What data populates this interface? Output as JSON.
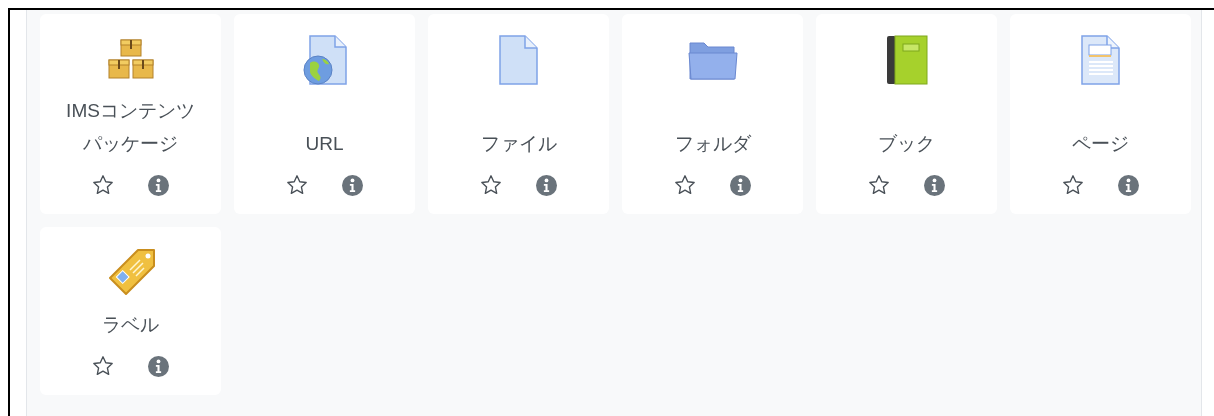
{
  "modules": [
    {
      "kind": "ims",
      "label_lines": [
        "IMSコンテンツ",
        "パッケージ"
      ],
      "starred": false
    },
    {
      "kind": "url",
      "label_lines": [
        "URL"
      ],
      "starred": false
    },
    {
      "kind": "file",
      "label_lines": [
        "ファイル"
      ],
      "starred": false
    },
    {
      "kind": "folder",
      "label_lines": [
        "フォルダ"
      ],
      "starred": false
    },
    {
      "kind": "book",
      "label_lines": [
        "ブック"
      ],
      "starred": false
    },
    {
      "kind": "page",
      "label_lines": [
        "ページ"
      ],
      "starred": false
    },
    {
      "kind": "label",
      "label_lines": [
        "ラベル"
      ],
      "starred": false
    }
  ]
}
